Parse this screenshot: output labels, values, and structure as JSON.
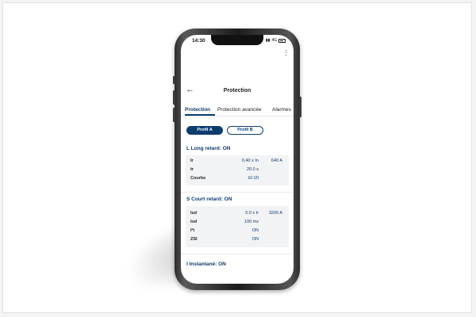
{
  "statusbar": {
    "time": "14:30",
    "signal": "4G"
  },
  "appbar": {
    "title": "Protection",
    "back_icon": "arrow-left-icon",
    "menu_icon": "kebab-icon"
  },
  "tabs": [
    {
      "label": "Protection",
      "active": true
    },
    {
      "label": "Protection avancée",
      "active": false
    },
    {
      "label": "Alarmes",
      "active": false
    }
  ],
  "profiles": [
    {
      "label": "Profil A",
      "selected": true
    },
    {
      "label": "Profil B",
      "selected": false
    }
  ],
  "sections": [
    {
      "title": "L Long retard: ON",
      "rows": [
        {
          "label": "Ir",
          "value": "0,40 x In",
          "value2": "640 A"
        },
        {
          "label": "tr",
          "value": "20.0 s",
          "value2": ""
        },
        {
          "label": "Courbe",
          "value": "EI I2t",
          "value2": ""
        }
      ]
    },
    {
      "title": "S Court retard: ON",
      "rows": [
        {
          "label": "Isd",
          "value": "5.0 x Ir",
          "value2": "3200 A"
        },
        {
          "label": "tsd",
          "value": "100 ms",
          "value2": ""
        },
        {
          "label": "I²t",
          "value": "ON",
          "value2": ""
        },
        {
          "label": "ZSI",
          "value": "ON",
          "value2": ""
        }
      ]
    },
    {
      "title": "I Instantané: ON",
      "rows": []
    }
  ],
  "colors": {
    "accent": "#0e3c6f",
    "card": "#f2f3f5"
  }
}
